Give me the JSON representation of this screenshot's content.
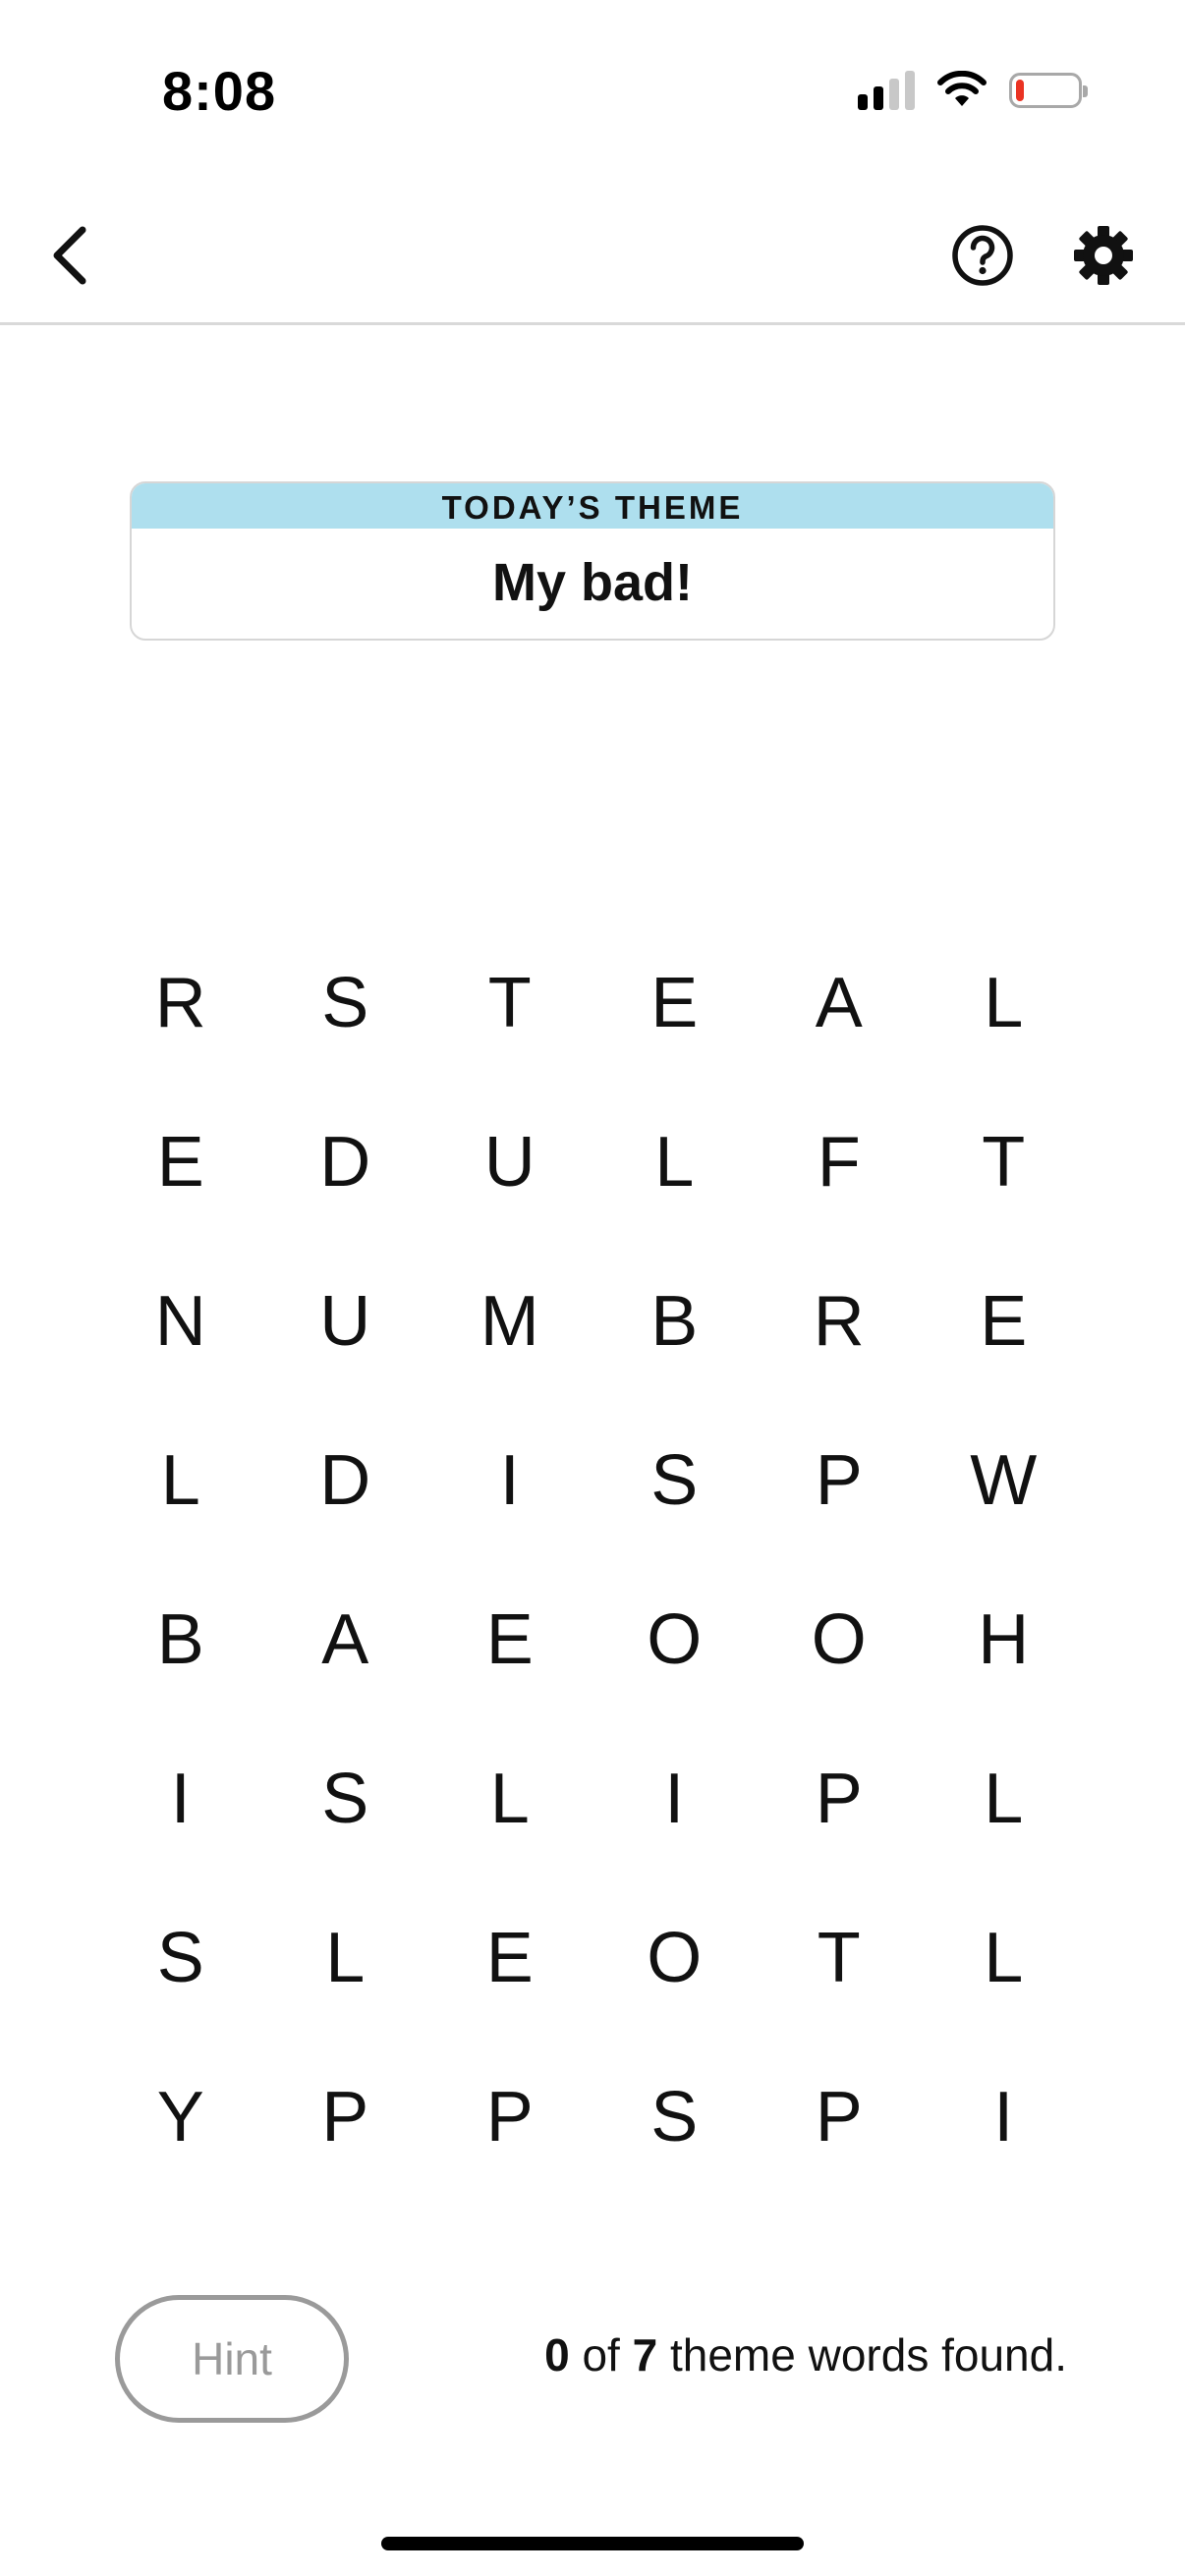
{
  "status_bar": {
    "time": "8:08",
    "signal_bars_active": 2,
    "signal_bars_total": 4,
    "battery_level_percent": 8,
    "battery_color": "#ea3323",
    "icons": [
      "signal-icon",
      "wifi-icon",
      "battery-icon"
    ]
  },
  "nav": {
    "back_icon": "chevron-left-icon",
    "help_icon": "help-circle-icon",
    "settings_icon": "gear-icon"
  },
  "theme": {
    "header": "TODAY’S THEME",
    "title": "My bad!",
    "header_color": "#aedfee"
  },
  "grid": {
    "rows": [
      [
        "R",
        "S",
        "T",
        "E",
        "A",
        "L"
      ],
      [
        "E",
        "D",
        "U",
        "L",
        "F",
        "T"
      ],
      [
        "N",
        "U",
        "M",
        "B",
        "R",
        "E"
      ],
      [
        "L",
        "D",
        "I",
        "S",
        "P",
        "W"
      ],
      [
        "B",
        "A",
        "E",
        "O",
        "O",
        "H"
      ],
      [
        "I",
        "S",
        "L",
        "I",
        "P",
        "L"
      ],
      [
        "S",
        "L",
        "E",
        "O",
        "T",
        "L"
      ],
      [
        "Y",
        "P",
        "P",
        "S",
        "P",
        "I"
      ]
    ]
  },
  "footer": {
    "hint_label": "Hint",
    "found_count": "0",
    "of_text": "of",
    "total_count": "7",
    "suffix_text": "theme words found."
  }
}
